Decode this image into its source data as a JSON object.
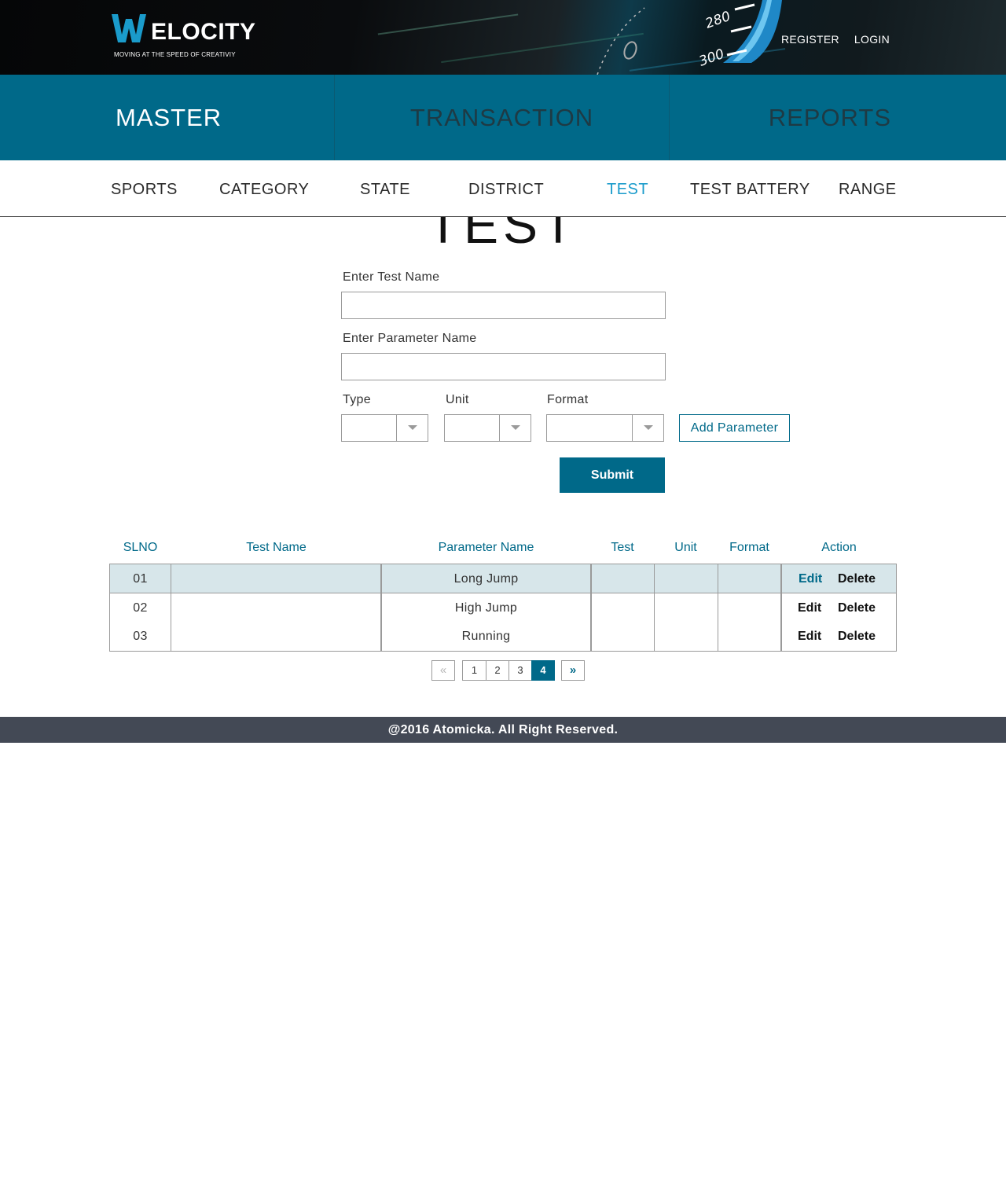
{
  "brand": {
    "name": "ELOCITY",
    "tagline": "MOVING AT THE SPEED OF CREATIVIY",
    "accent": "#1a9bcb"
  },
  "speedometer": {
    "mark_280": "280",
    "mark_300": "300"
  },
  "header_links": {
    "register": "REGISTER",
    "login": "LOGIN"
  },
  "main_nav": {
    "master": "MASTER",
    "transaction": "TRANSACTION",
    "reports": "REPORTS",
    "active": "MASTER",
    "color": "#006989"
  },
  "sub_nav": {
    "items": [
      "SPORTS",
      "CATEGORY",
      "STATE",
      "DISTRICT",
      "TEST",
      "TEST BATTERY",
      "RANGE"
    ],
    "active": "TEST"
  },
  "page": {
    "title": "TEST"
  },
  "form": {
    "test_name_label": "Enter Test  Name",
    "test_name_value": "",
    "parameter_name_label": "Enter Parameter Name",
    "parameter_name_value": "",
    "type_label": "Type",
    "type_value": "",
    "unit_label": "Unit",
    "unit_value": "",
    "format_label": "Format",
    "format_value": "",
    "add_parameter": "Add Parameter",
    "submit": "Submit"
  },
  "table": {
    "headers": [
      "SLNO",
      "Test Name",
      "Parameter Name",
      "Test",
      "Unit",
      "Format",
      "Action"
    ],
    "rows": [
      {
        "slno": "01",
        "test_name": "",
        "parameter_name": "Long Jump",
        "test": "",
        "unit": "",
        "format": "",
        "edit": "Edit",
        "delete": "Delete",
        "highlighted": true
      },
      {
        "slno": "02",
        "test_name": "",
        "parameter_name": "High Jump",
        "test": "",
        "unit": "",
        "format": "",
        "edit": "Edit",
        "delete": "Delete",
        "highlighted": false
      },
      {
        "slno": "03",
        "test_name": "",
        "parameter_name": "Running",
        "test": "",
        "unit": "",
        "format": "",
        "edit": "Edit",
        "delete": "Delete",
        "highlighted": false
      }
    ]
  },
  "pagination": {
    "prev": "«",
    "next": "»",
    "pages": [
      "1",
      "2",
      "3",
      "4"
    ],
    "current": "4"
  },
  "footer": {
    "text": "@2016 Atomicka. All Right Reserved."
  }
}
